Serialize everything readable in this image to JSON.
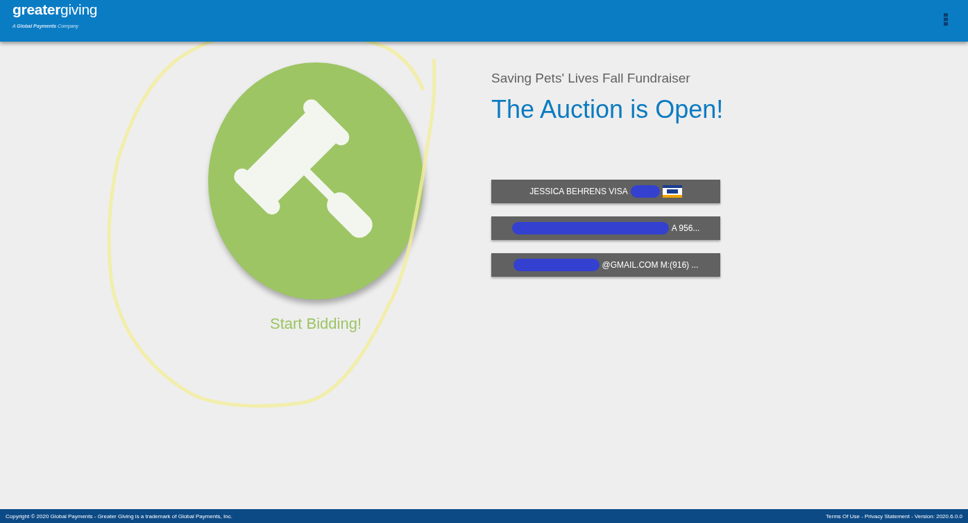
{
  "header": {
    "logo": "**greater**giving",
    "tagline": "A **Global Payments** Company"
  },
  "action": {
    "label": "Start Bidding!"
  },
  "event": {
    "name": "Saving Pets' Lives Fall Fundraiser",
    "status": "The Auction is Open!"
  },
  "accounts": [
    {
      "kind": "card",
      "label": "JESSICA BEHRENS VISA",
      "redacted": true
    },
    {
      "kind": "address",
      "label": "A 956...",
      "redacted": true
    },
    {
      "kind": "contact",
      "label": "@GMAIL.COM M:(916) ...",
      "redacted": true
    }
  ],
  "footer": {
    "copyright": "Copyright © 2020 Global Payments  - Greater Giving is a trademark of Global Payments, Inc.",
    "legal": "Terms Of Use - Privacy Statement - Version: 2020.6.0.0"
  }
}
